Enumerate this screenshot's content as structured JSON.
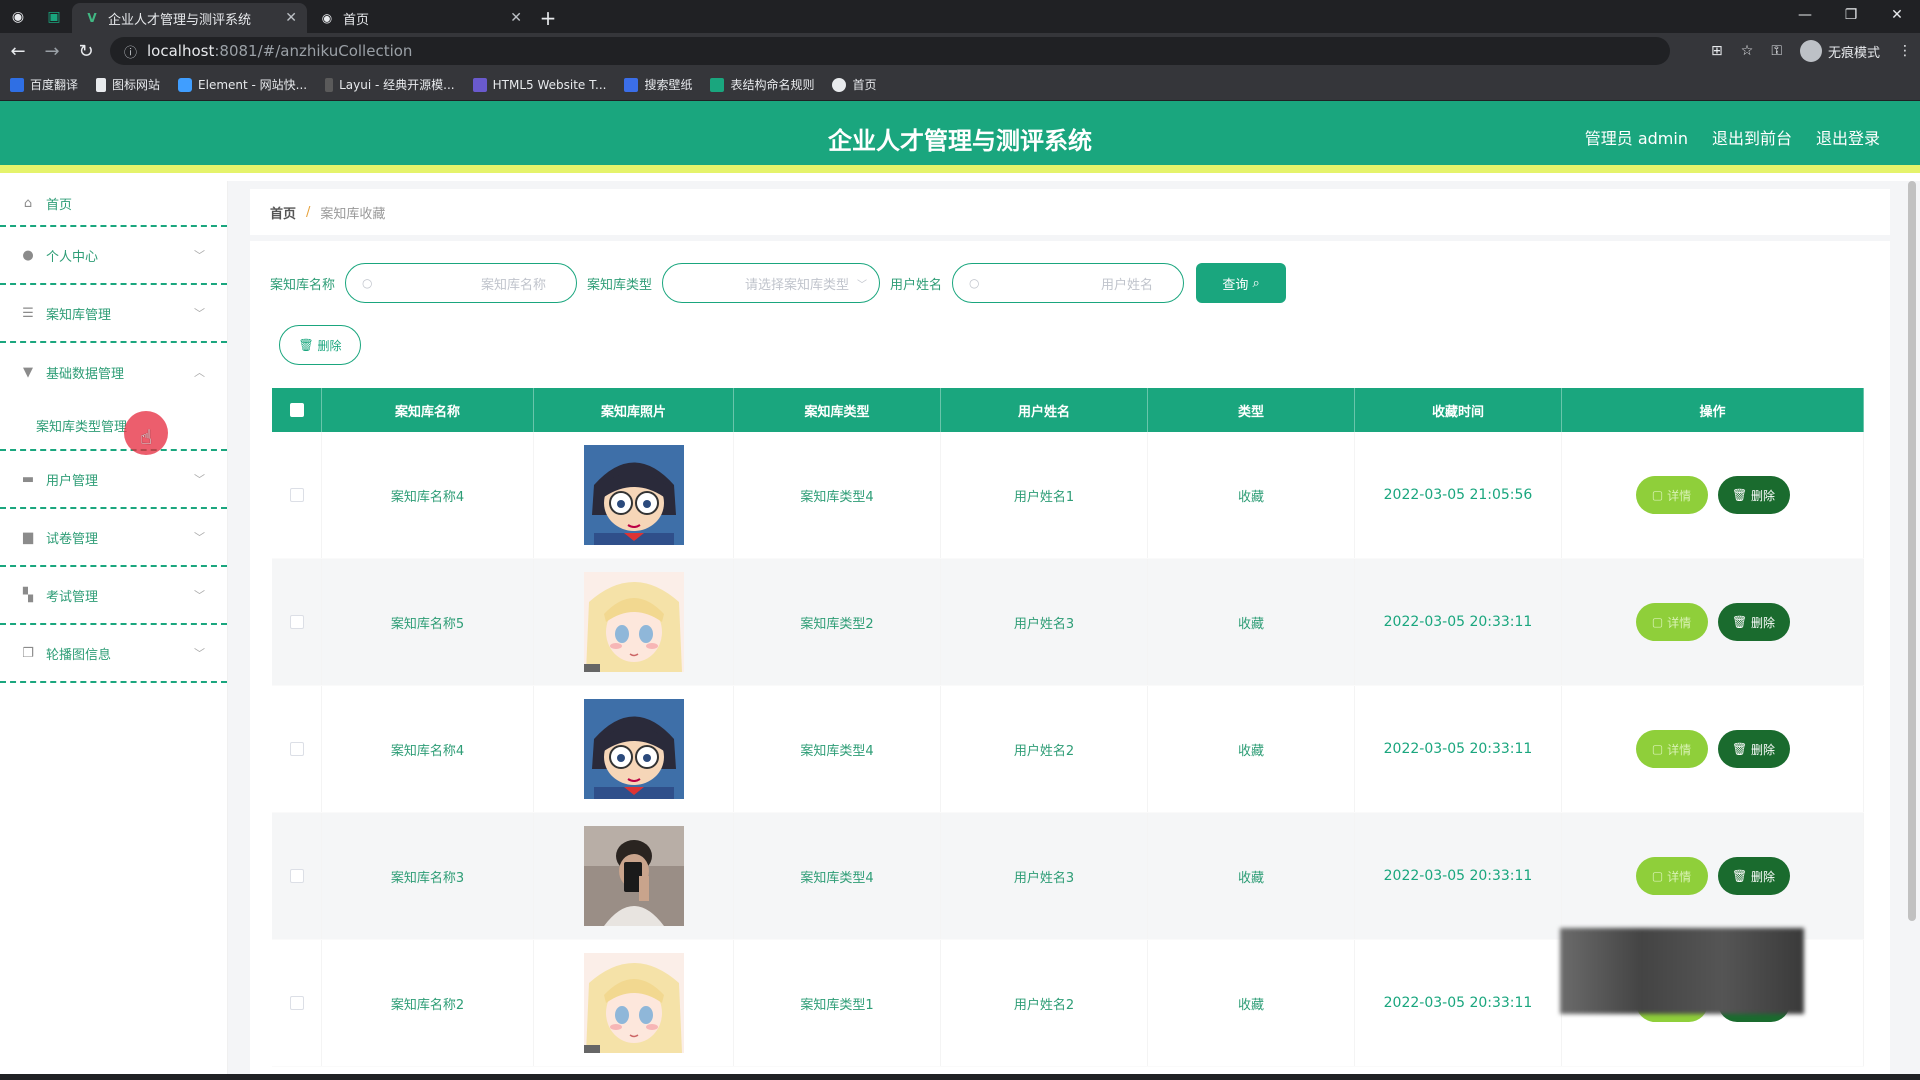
{
  "browser": {
    "tabs": [
      {
        "label": "企业人才管理与测评系统",
        "active": true
      },
      {
        "label": "首页",
        "active": false
      }
    ],
    "url_host": "localhost",
    "url_path": ":8081/#/anzhikuCollection",
    "profile_label": "无痕模式",
    "bookmarks": [
      "百度翻译",
      "图标网站",
      "Element - 网站快...",
      "Layui - 经典开源模...",
      "HTML5 Website T...",
      "搜索壁纸",
      "表结构命名规则",
      "首页"
    ]
  },
  "header": {
    "title": "企业人才管理与测评系统",
    "admin": "管理员 admin",
    "front": "退出到前台",
    "logout": "退出登录",
    "accent": "#1aa67e",
    "stripe": "#e5f36b"
  },
  "sidebar": {
    "home": "首页",
    "items": [
      "个人中心",
      "案知库管理",
      "基础数据管理",
      "用户管理",
      "试卷管理",
      "考试管理",
      "轮播图信息"
    ],
    "sub_item": "案知库类型管理"
  },
  "breadcrumb": {
    "home": "首页",
    "sep": "/",
    "current": "案知库收藏"
  },
  "search": {
    "name_label": "案知库名称",
    "name_placeholder": "案知库名称",
    "type_label": "案知库类型",
    "type_placeholder": "请选择案知库类型",
    "user_label": "用户姓名",
    "user_placeholder": "用户姓名",
    "query_button": "查询",
    "delete_button": "删除"
  },
  "table": {
    "headers": [
      "案知库名称",
      "案知库照片",
      "案知库类型",
      "用户姓名",
      "类型",
      "收藏时间",
      "操作"
    ],
    "detail_label": "详情",
    "delete_label": "删除",
    "rows": [
      {
        "name": "案知库名称4",
        "photo": "anime-boy-glasses",
        "type": "案知库类型4",
        "user": "用户姓名1",
        "kind": "收藏",
        "time": "2022-03-05 21:05:56"
      },
      {
        "name": "案知库名称5",
        "photo": "anime-girl-blonde",
        "type": "案知库类型2",
        "user": "用户姓名3",
        "kind": "收藏",
        "time": "2022-03-05 20:33:11"
      },
      {
        "name": "案知库名称4",
        "photo": "anime-boy-glasses",
        "type": "案知库类型4",
        "user": "用户姓名2",
        "kind": "收藏",
        "time": "2022-03-05 20:33:11"
      },
      {
        "name": "案知库名称3",
        "photo": "person-selfie",
        "type": "案知库类型4",
        "user": "用户姓名3",
        "kind": "收藏",
        "time": "2022-03-05 20:33:11"
      },
      {
        "name": "案知库名称2",
        "photo": "anime-girl-blonde",
        "type": "案知库类型1",
        "user": "用户姓名2",
        "kind": "收藏",
        "time": "2022-03-05 20:33:11"
      }
    ]
  }
}
